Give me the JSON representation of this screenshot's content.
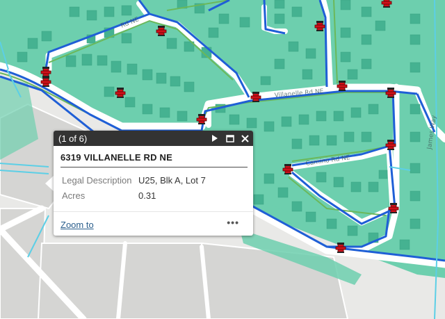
{
  "map": {
    "streets": [
      "Rd NE",
      "Villanelle Rd NE",
      "Camino Rd NE",
      "James Way"
    ],
    "colors": {
      "background": "#e9e9e7",
      "parcel_green": "#6dcfae",
      "lot_green": "#45b291",
      "water_main": "#1f5fd6",
      "service_line": "#5ccfe6",
      "sewer_green": "#6bb85a",
      "hydrant_red": "#d0101a"
    },
    "hydrant_icon": "fire-hydrant-icon"
  },
  "popup": {
    "counter": "(1 of 6)",
    "title": "6319 VILLANELLE RD NE",
    "fields": [
      {
        "label": "Legal Description",
        "value": "U25, Blk A, Lot 7"
      },
      {
        "label": "Acres",
        "value": "0.31"
      }
    ],
    "zoom_label": "Zoom to",
    "more_label": "•••"
  }
}
